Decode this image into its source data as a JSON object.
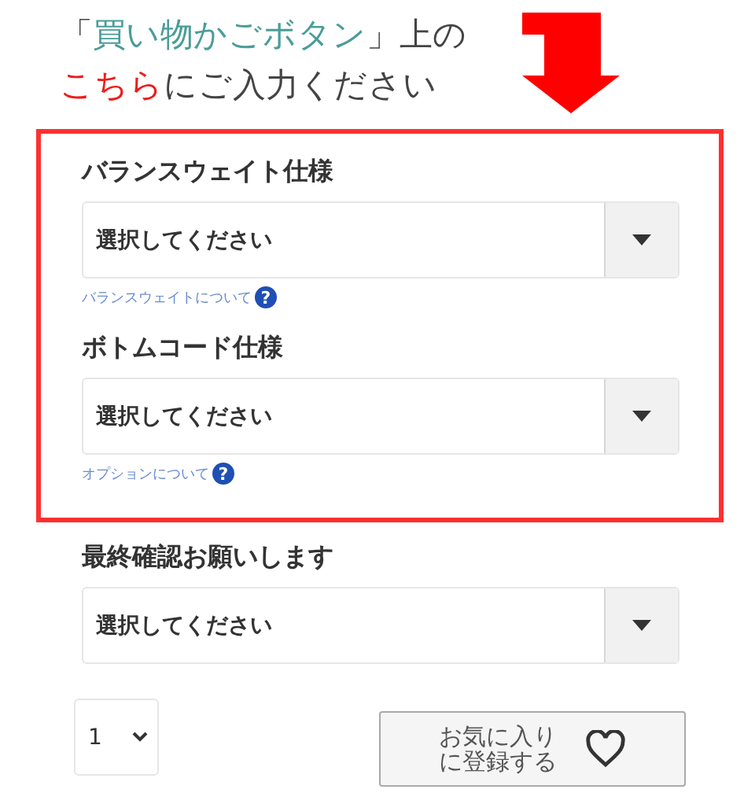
{
  "header": {
    "lines": [
      [
        {
          "text": "「",
          "color": "#444444"
        },
        {
          "text": "買い物かごボタン",
          "color": "#4a9d98"
        },
        {
          "text": "」上の",
          "color": "#444444"
        }
      ],
      [
        {
          "text": "こちら",
          "color": "#ee1c1c"
        },
        {
          "text": "にご入力ください",
          "color": "#444444"
        }
      ]
    ]
  },
  "options": [
    {
      "label": "バランスウェイト仕様",
      "value": "選択してください",
      "help": "バランスウェイトについて",
      "help_icon": "?",
      "highlighted": true
    },
    {
      "label": "ボトムコード仕様",
      "value": "選択してください",
      "help": "オプションについて",
      "help_icon": "?",
      "highlighted": true
    },
    {
      "label": "最終確認お願いします",
      "value": "選択してください",
      "highlighted": false
    }
  ],
  "quantity": {
    "value": "1"
  },
  "favorite_button": {
    "label_lines": [
      "お気に入り",
      "に登録する"
    ]
  }
}
